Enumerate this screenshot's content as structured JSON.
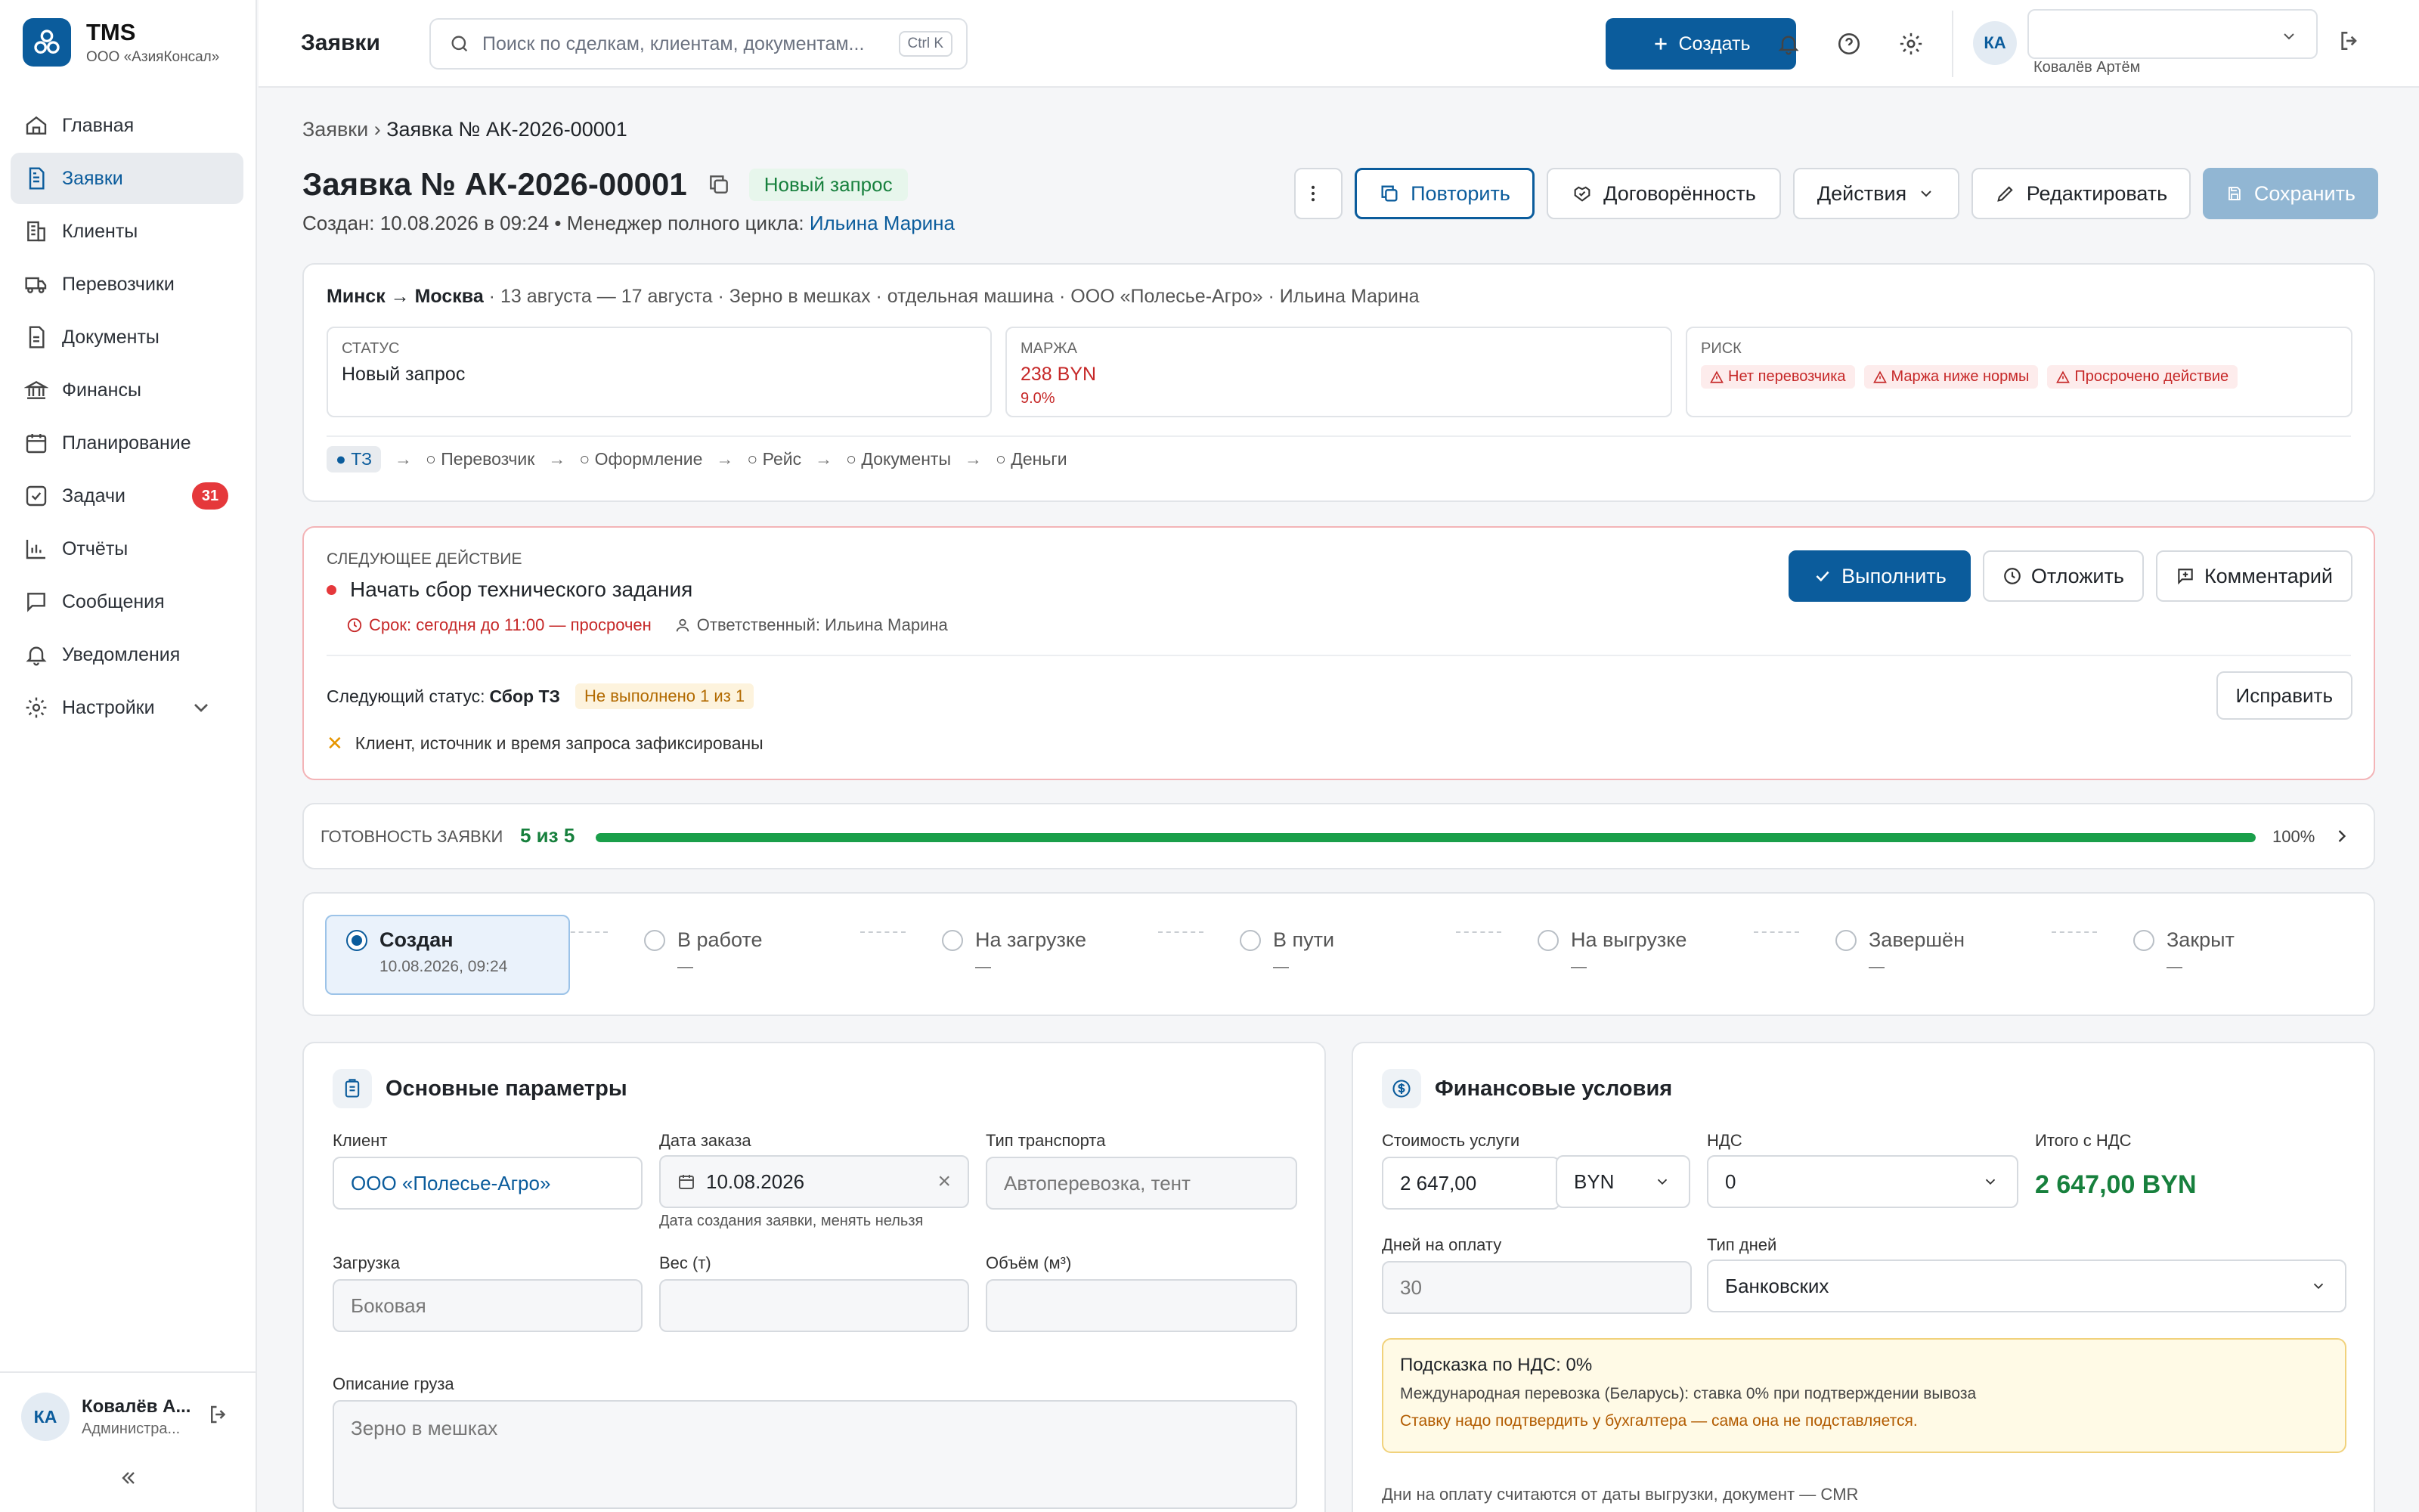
{
  "brand": {
    "title": "TMS",
    "subtitle": "ООО «АзияКонсал»"
  },
  "nav": [
    {
      "label": "Главная",
      "icon": "home-icon"
    },
    {
      "label": "Заявки",
      "icon": "file-icon",
      "active": true
    },
    {
      "label": "Клиенты",
      "icon": "building-icon"
    },
    {
      "label": "Перевозчики",
      "icon": "truck-icon"
    },
    {
      "label": "Документы",
      "icon": "document-icon"
    },
    {
      "label": "Финансы",
      "icon": "bank-icon"
    },
    {
      "label": "Планирование",
      "icon": "calendar-icon"
    },
    {
      "label": "Задачи",
      "icon": "checkbox-icon",
      "badge": "31"
    },
    {
      "label": "Отчёты",
      "icon": "chart-icon"
    },
    {
      "label": "Сообщения",
      "icon": "message-icon"
    },
    {
      "label": "Уведомления",
      "icon": "bell-icon"
    },
    {
      "label": "Настройки",
      "icon": "gear-icon",
      "expandable": true
    }
  ],
  "sidebar_user": {
    "initials": "КА",
    "name": "Ковалёв А...",
    "role": "Администра..."
  },
  "topbar": {
    "title": "Заявки",
    "search_placeholder": "Поиск по сделкам, клиентам, документам...",
    "search_shortcut": "Ctrl K",
    "create_label": "Создать",
    "user_initials": "КА",
    "user_name": "Ковалёв Артём"
  },
  "breadcrumb": {
    "parent": "Заявки",
    "sep": "›",
    "current": "Заявка № АК-2026-00001"
  },
  "header": {
    "title": "Заявка № АК-2026-00001",
    "status": "Новый запрос",
    "created_prefix": "Создан: 10.08.2026 в 09:24 • Менеджер полного цикла: ",
    "manager": "Ильина Марина",
    "buttons": {
      "repeat": "Повторить",
      "agreement": "Договорённость",
      "actions": "Действия",
      "edit": "Редактировать",
      "save": "Сохранить"
    }
  },
  "summary": {
    "route": "Минск → Москва",
    "details": " · 13 августа — 17 августа · Зерно в мешках · отдельная машина · ООО «Полесье-Агро» · Ильина Марина",
    "status_label": "Статус",
    "status_value": "Новый запрос",
    "margin_label": "Маржа",
    "margin_value": "238 BYN",
    "margin_pct": "9.0%",
    "risk_label": "Риск",
    "risks": [
      "Нет перевозчика",
      "Маржа ниже нормы",
      "Просрочено действие"
    ],
    "stages": [
      "● ТЗ",
      "○ Перевозчик",
      "○ Оформление",
      "○ Рейс",
      "○ Документы",
      "○ Деньги"
    ],
    "stage_arrow": "→"
  },
  "next_action": {
    "label": "Следующее действие",
    "title": "Начать сбор технического задания",
    "deadline": "Срок: сегодня до 11:00 — просрочен",
    "owner": "Ответственный: Ильина Марина",
    "btn_done": "Выполнить",
    "btn_postpone": "Отложить",
    "btn_comment": "Комментарий",
    "next_status_prefix": "Следующий статус: ",
    "next_status": "Сбор ТЗ",
    "not_done": "Не выполнено 1 из 1",
    "btn_fix": "Исправить",
    "check_mark": "✕",
    "check_text": "Клиент, источник и время запроса зафиксированы"
  },
  "readiness": {
    "label": "Готовность заявки",
    "value": "5 из 5",
    "percent_text": "100%",
    "progress": 1.0
  },
  "flow": [
    {
      "label": "Создан",
      "sub": "10.08.2026, 09:24",
      "active": true
    },
    {
      "label": "В работе",
      "sub": "—"
    },
    {
      "label": "На загрузке",
      "sub": "—"
    },
    {
      "label": "В пути",
      "sub": "—"
    },
    {
      "label": "На выгрузке",
      "sub": "—"
    },
    {
      "label": "Завершён",
      "sub": "—"
    },
    {
      "label": "Закрыт",
      "sub": "—"
    }
  ],
  "params": {
    "title": "Основные параметры",
    "client_label": "Клиент",
    "client_value": "ООО «Полесье-Агро»",
    "date_label": "Дата заказа",
    "date_value": "10.08.2026",
    "date_hint": "Дата создания заявки, менять нельзя",
    "date_clear": "×",
    "transport_label": "Тип транспорта",
    "transport_value": "Автоперевозка, тент",
    "loading_label": "Загрузка",
    "loading_value": "Боковая",
    "weight_label": "Вес (т)",
    "weight_value": "",
    "volume_label": "Объём (м³)",
    "volume_value": "",
    "desc_label": "Описание груза",
    "desc_value": "Зерно в мешках"
  },
  "finance": {
    "title": "Финансовые условия",
    "cost_label": "Стоимость услуги",
    "cost_value": "2 647,00",
    "currency": "BYN",
    "vat_label": "НДС",
    "vat_value": "0",
    "total_label": "Итого с НДС",
    "total_value": "2 647,00 BYN",
    "days_label": "Дней на оплату",
    "days_value": "30",
    "daytype_label": "Тип дней",
    "daytype_value": "Банковских",
    "hint_title": "Подсказка по НДС: 0%",
    "hint_desc": "Международная перевозка (Беларусь): ставка 0% при подтверждении вывоза",
    "hint_warn": "Ставку надо подтвердить у бухгалтера — сама она не подставляется.",
    "note": "Дни на оплату считаются от даты выгрузки, документ — CMR"
  },
  "colors": {
    "primary": "#0b5c9c",
    "success": "#17803d",
    "danger": "#e5383b",
    "warning": "#b26a00"
  }
}
